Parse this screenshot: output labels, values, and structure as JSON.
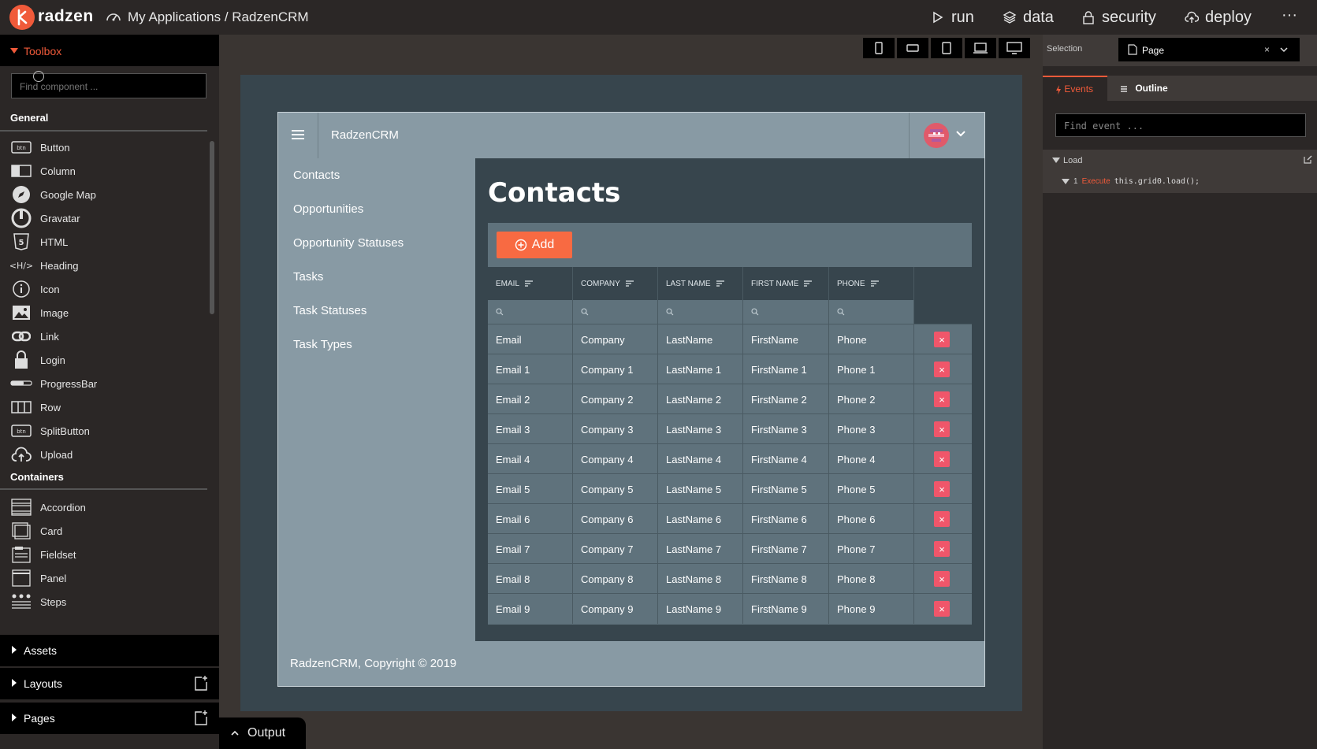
{
  "topbar": {
    "logo_text": "radzen",
    "breadcrumb": "My Applications / RadzenCRM",
    "nav": [
      {
        "label": "run",
        "icon": "play-icon"
      },
      {
        "label": "data",
        "icon": "layers-icon"
      },
      {
        "label": "security",
        "icon": "lock-icon"
      },
      {
        "label": "deploy",
        "icon": "cloud-upload-icon"
      }
    ],
    "more": "···"
  },
  "toolbox": {
    "title": "Toolbox",
    "search_placeholder": "Find component ...",
    "groups": [
      {
        "title": "General",
        "items": [
          "Button",
          "Column",
          "Google Map",
          "Gravatar",
          "HTML",
          "Heading",
          "Icon",
          "Image",
          "Link",
          "Login",
          "ProgressBar",
          "Row",
          "SplitButton",
          "Upload"
        ]
      },
      {
        "title": "Containers",
        "items": [
          "Accordion",
          "Card",
          "Fieldset",
          "Panel",
          "Steps"
        ]
      }
    ],
    "sections": [
      "Assets",
      "Layouts",
      "Pages"
    ]
  },
  "output_label": "Output",
  "app": {
    "title": "RadzenCRM",
    "nav": [
      "Contacts",
      "Opportunities",
      "Opportunity Statuses",
      "Tasks",
      "Task Statuses",
      "Task Types"
    ],
    "page_title": "Contacts",
    "add_label": "Add",
    "columns": [
      "EMAIL",
      "COMPANY",
      "LAST NAME",
      "FIRST NAME",
      "PHONE"
    ],
    "rows": [
      [
        "Email",
        "Company",
        "LastName",
        "FirstName",
        "Phone"
      ],
      [
        "Email 1",
        "Company 1",
        "LastName 1",
        "FirstName 1",
        "Phone 1"
      ],
      [
        "Email 2",
        "Company 2",
        "LastName 2",
        "FirstName 2",
        "Phone 2"
      ],
      [
        "Email 3",
        "Company 3",
        "LastName 3",
        "FirstName 3",
        "Phone 3"
      ],
      [
        "Email 4",
        "Company 4",
        "LastName 4",
        "FirstName 4",
        "Phone 4"
      ],
      [
        "Email 5",
        "Company 5",
        "LastName 5",
        "FirstName 5",
        "Phone 5"
      ],
      [
        "Email 6",
        "Company 6",
        "LastName 6",
        "FirstName 6",
        "Phone 6"
      ],
      [
        "Email 7",
        "Company 7",
        "LastName 7",
        "FirstName 7",
        "Phone 7"
      ],
      [
        "Email 8",
        "Company 8",
        "LastName 8",
        "FirstName 8",
        "Phone 8"
      ],
      [
        "Email 9",
        "Company 9",
        "LastName 9",
        "FirstName 9",
        "Phone 9"
      ]
    ],
    "delete_glyph": "×",
    "footer": "RadzenCRM, Copyright © 2019"
  },
  "right_panel": {
    "selection_label": "Selection",
    "selection_value": "Page",
    "clear_glyph": "×",
    "tabs": [
      "Events",
      "Outline"
    ],
    "find_event_placeholder": "Find event ...",
    "event_name": "Load",
    "action_index": "1",
    "action_type": "Execute",
    "action_code": "this.grid0.load();"
  },
  "colors": {
    "accent": "#f05a3a",
    "add_button": "#f86a42",
    "delete_button": "#f0566a",
    "app_header": "#889aa4",
    "grid_row": "#5f727c"
  }
}
